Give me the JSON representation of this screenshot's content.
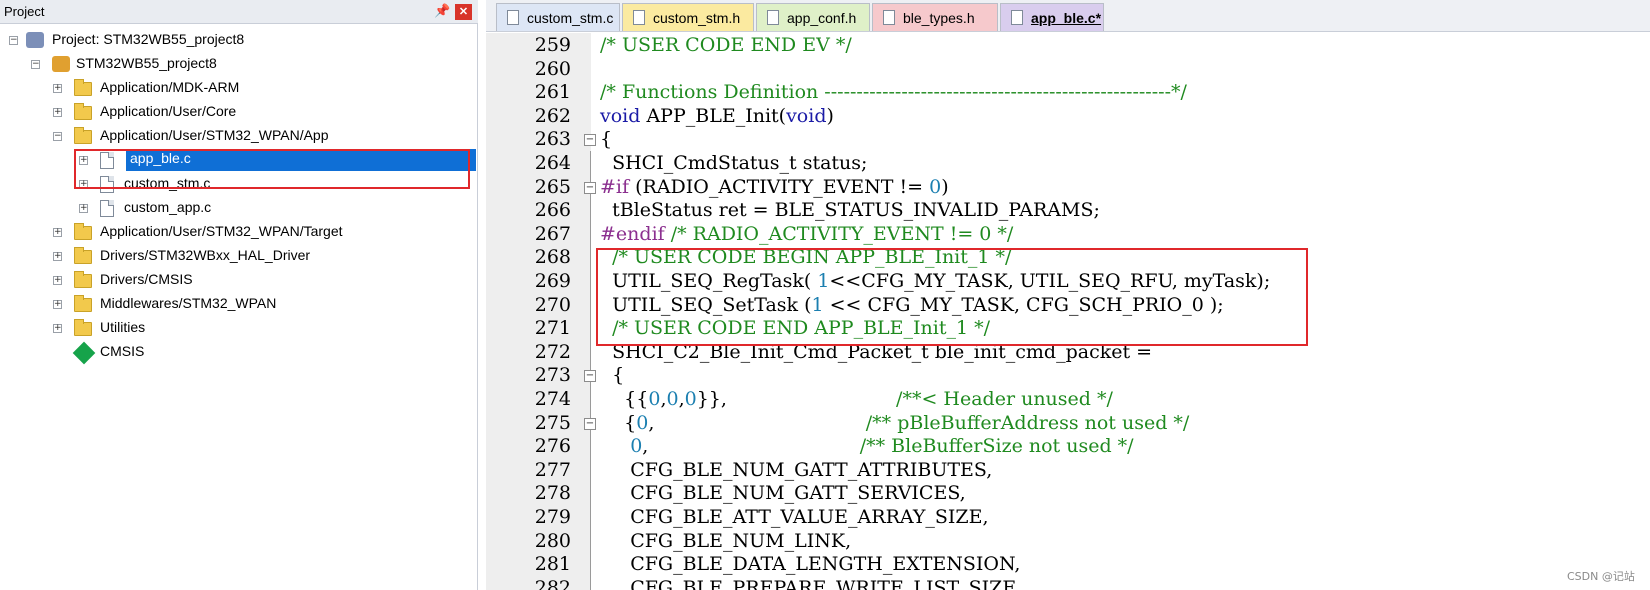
{
  "project_panel": {
    "title": "Project",
    "pin_icon": "pin-icon",
    "close_icon": "close-icon",
    "tree": [
      {
        "label": "Project: STM32WB55_project8",
        "icon": "project-icon",
        "expander": "−"
      },
      {
        "label": "STM32WB55_project8",
        "icon": "target-icon",
        "expander": "−"
      },
      {
        "label": "Application/MDK-ARM",
        "icon": "folder-icon",
        "expander": "+"
      },
      {
        "label": "Application/User/Core",
        "icon": "folder-icon",
        "expander": "+"
      },
      {
        "label": "Application/User/STM32_WPAN/App",
        "icon": "folder-open-icon",
        "expander": "−"
      },
      {
        "label": "app_ble.c",
        "icon": "file-icon",
        "expander": "+",
        "selected": true
      },
      {
        "label": "custom_stm.c",
        "icon": "file-icon",
        "expander": "+"
      },
      {
        "label": "custom_app.c",
        "icon": "file-icon",
        "expander": "+"
      },
      {
        "label": "Application/User/STM32_WPAN/Target",
        "icon": "folder-icon",
        "expander": "+"
      },
      {
        "label": "Drivers/STM32WBxx_HAL_Driver",
        "icon": "folder-icon",
        "expander": "+"
      },
      {
        "label": "Drivers/CMSIS",
        "icon": "folder-icon",
        "expander": "+"
      },
      {
        "label": "Middlewares/STM32_WPAN",
        "icon": "folder-icon",
        "expander": "+"
      },
      {
        "label": "Utilities",
        "icon": "folder-icon",
        "expander": "+"
      },
      {
        "label": "CMSIS",
        "icon": "cmsis-icon",
        "expander": ""
      }
    ]
  },
  "tabs": [
    {
      "label": "custom_stm.c",
      "color": "#dde6f5",
      "active": false
    },
    {
      "label": "custom_stm.h",
      "color": "#fbeaa0",
      "active": false
    },
    {
      "label": "app_conf.h",
      "color": "#dff0c8",
      "active": false
    },
    {
      "label": "ble_types.h",
      "color": "#f6c9cc",
      "active": false
    },
    {
      "label": "app_ble.c*",
      "color": "#d9cdee",
      "active": true
    }
  ],
  "editor": {
    "lines": [
      {
        "no": "259",
        "parts": [
          {
            "t": "/* USER CODE END EV */",
            "c": "comment"
          }
        ]
      },
      {
        "no": "260",
        "parts": []
      },
      {
        "no": "261",
        "parts": [
          {
            "t": "/* Functions Definition ------------------------------------------------------*/",
            "c": "comment"
          }
        ]
      },
      {
        "no": "262",
        "parts": [
          {
            "t": "void",
            "c": "keyword"
          },
          {
            "t": " APP_BLE_Init(",
            "c": ""
          },
          {
            "t": "void",
            "c": "keyword"
          },
          {
            "t": ")",
            "c": ""
          }
        ]
      },
      {
        "no": "263",
        "parts": [
          {
            "t": "{",
            "c": ""
          }
        ]
      },
      {
        "no": "264",
        "parts": [
          {
            "t": "  SHCI_CmdStatus_t status;",
            "c": ""
          }
        ]
      },
      {
        "no": "265",
        "parts": [
          {
            "t": "#if",
            "c": "preproc"
          },
          {
            "t": " (RADIO_ACTIVITY_EVENT != ",
            "c": ""
          },
          {
            "t": "0",
            "c": "number"
          },
          {
            "t": ")",
            "c": ""
          }
        ]
      },
      {
        "no": "266",
        "parts": [
          {
            "t": "  tBleStatus ret = BLE_STATUS_INVALID_PARAMS;",
            "c": ""
          }
        ]
      },
      {
        "no": "267",
        "parts": [
          {
            "t": "#endif",
            "c": "preproc"
          },
          {
            "t": " /* RADIO_ACTIVITY_EVENT != 0 */",
            "c": "comment"
          }
        ]
      },
      {
        "no": "268",
        "parts": [
          {
            "t": "  /* USER CODE BEGIN APP_BLE_Init_1 */",
            "c": "comment"
          }
        ]
      },
      {
        "no": "269",
        "parts": [
          {
            "t": "  UTIL_SEQ_RegTask( ",
            "c": ""
          },
          {
            "t": "1",
            "c": "number"
          },
          {
            "t": "<<CFG_MY_TASK, UTIL_SEQ_RFU, myTask);",
            "c": ""
          }
        ]
      },
      {
        "no": "270",
        "parts": [
          {
            "t": "  UTIL_SEQ_SetTask (",
            "c": ""
          },
          {
            "t": "1",
            "c": "number"
          },
          {
            "t": " << CFG_MY_TASK, CFG_SCH_PRIO_0 );",
            "c": ""
          }
        ]
      },
      {
        "no": "271",
        "parts": [
          {
            "t": "  /* USER CODE END APP_BLE_Init_1 */",
            "c": "comment"
          }
        ]
      },
      {
        "no": "272",
        "parts": [
          {
            "t": "  SHCI_C2_Ble_Init_Cmd_Packet_t ble_init_cmd_packet =",
            "c": ""
          }
        ]
      },
      {
        "no": "273",
        "parts": [
          {
            "t": "  {",
            "c": ""
          }
        ]
      },
      {
        "no": "274",
        "parts": [
          {
            "t": "    {{",
            "c": ""
          },
          {
            "t": "0",
            "c": "number"
          },
          {
            "t": ",",
            "c": ""
          },
          {
            "t": "0",
            "c": "number"
          },
          {
            "t": ",",
            "c": ""
          },
          {
            "t": "0",
            "c": "number"
          },
          {
            "t": "}},                            ",
            "c": ""
          },
          {
            "t": "/**< Header unused */",
            "c": "comment"
          }
        ]
      },
      {
        "no": "275",
        "parts": [
          {
            "t": "    {",
            "c": ""
          },
          {
            "t": "0",
            "c": "number"
          },
          {
            "t": ",                                   ",
            "c": ""
          },
          {
            "t": "/** pBleBufferAddress not used */",
            "c": "comment"
          }
        ]
      },
      {
        "no": "276",
        "parts": [
          {
            "t": "     ",
            "c": ""
          },
          {
            "t": "0",
            "c": "number"
          },
          {
            "t": ",                                   ",
            "c": ""
          },
          {
            "t": "/** BleBufferSize not used */",
            "c": "comment"
          }
        ]
      },
      {
        "no": "277",
        "parts": [
          {
            "t": "     CFG_BLE_NUM_GATT_ATTRIBUTES,",
            "c": ""
          }
        ]
      },
      {
        "no": "278",
        "parts": [
          {
            "t": "     CFG_BLE_NUM_GATT_SERVICES,",
            "c": ""
          }
        ]
      },
      {
        "no": "279",
        "parts": [
          {
            "t": "     CFG_BLE_ATT_VALUE_ARRAY_SIZE,",
            "c": ""
          }
        ]
      },
      {
        "no": "280",
        "parts": [
          {
            "t": "     CFG_BLE_NUM_LINK,",
            "c": ""
          }
        ]
      },
      {
        "no": "281",
        "parts": [
          {
            "t": "     CFG_BLE_DATA_LENGTH_EXTENSION,",
            "c": ""
          }
        ]
      },
      {
        "no": "282",
        "parts": [
          {
            "t": "     CFG_BLE_PREPARE_WRITE_LIST_SIZE,",
            "c": ""
          }
        ]
      }
    ]
  },
  "watermark": "CSDN @记站"
}
